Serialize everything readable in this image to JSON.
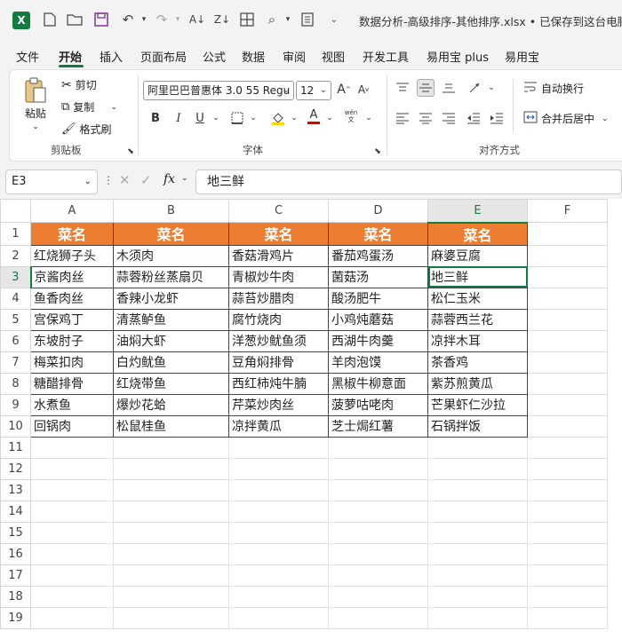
{
  "titlebar": {
    "app_icon": "X",
    "doc_title": "数据分析-高级排序-其他排序.xlsx • 已保存到这台电脑"
  },
  "menu": [
    "文件",
    "开始",
    "插入",
    "页面布局",
    "公式",
    "数据",
    "审阅",
    "视图",
    "开发工具",
    "易用宝 plus",
    "易用宝"
  ],
  "ribbon": {
    "clipboard": {
      "paste": "粘贴",
      "cut": "剪切",
      "copy": "复制",
      "format_painter": "格式刷",
      "label": "剪贴板"
    },
    "font": {
      "name": "阿里巴巴普惠体 3.0 55 Regu",
      "size": "12",
      "bold": "B",
      "italic": "I",
      "underline": "U",
      "label": "字体",
      "font_color_letter": "A",
      "wen": "wén\n文",
      "grow": "A",
      "shrink": "A"
    },
    "alignment": {
      "wrap": "自动换行",
      "merge": "合并后居中",
      "label": "对齐方式"
    }
  },
  "formula_bar": {
    "name_box": "E3",
    "fx": "fx",
    "content": "地三鲜"
  },
  "sheet": {
    "columns": [
      "A",
      "B",
      "C",
      "D",
      "E",
      "F"
    ],
    "rows": [
      "1",
      "2",
      "3",
      "4",
      "5",
      "6",
      "7",
      "8",
      "9",
      "10",
      "11",
      "12",
      "13",
      "14",
      "15",
      "16",
      "17",
      "18",
      "19"
    ],
    "header": [
      "菜名",
      "菜名",
      "菜名",
      "菜名",
      "菜名"
    ],
    "data": [
      [
        "红烧狮子头",
        "木须肉",
        "香菇滑鸡片",
        "番茄鸡蛋汤",
        "麻婆豆腐"
      ],
      [
        "京酱肉丝",
        "蒜蓉粉丝蒸扇贝",
        "青椒炒牛肉",
        "菌菇汤",
        "地三鲜"
      ],
      [
        "鱼香肉丝",
        "香辣小龙虾",
        "蒜苔炒腊肉",
        "酸汤肥牛",
        "松仁玉米"
      ],
      [
        "宫保鸡丁",
        "清蒸鲈鱼",
        "腐竹烧肉",
        "小鸡炖蘑菇",
        "蒜蓉西兰花"
      ],
      [
        "东坡肘子",
        "油焖大虾",
        "洋葱炒鱿鱼须",
        "西湖牛肉羹",
        "凉拌木耳"
      ],
      [
        "梅菜扣肉",
        "白灼鱿鱼",
        "豆角焖排骨",
        "羊肉泡馍",
        "茶香鸡"
      ],
      [
        "糖醋排骨",
        "红烧带鱼",
        "西红柿炖牛腩",
        "黑椒牛柳意面",
        "紫苏煎黄瓜"
      ],
      [
        "水煮鱼",
        "爆炒花蛤",
        "芹菜炒肉丝",
        "菠萝咕咾肉",
        "芒果虾仁沙拉"
      ],
      [
        "回锅肉",
        "松鼠桂鱼",
        "凉拌黄瓜",
        "芝士焗红薯",
        "石锅拌饭"
      ]
    ],
    "active_cell": "E3",
    "header_color": "#ed7d31",
    "accent_color": "#107c41"
  }
}
